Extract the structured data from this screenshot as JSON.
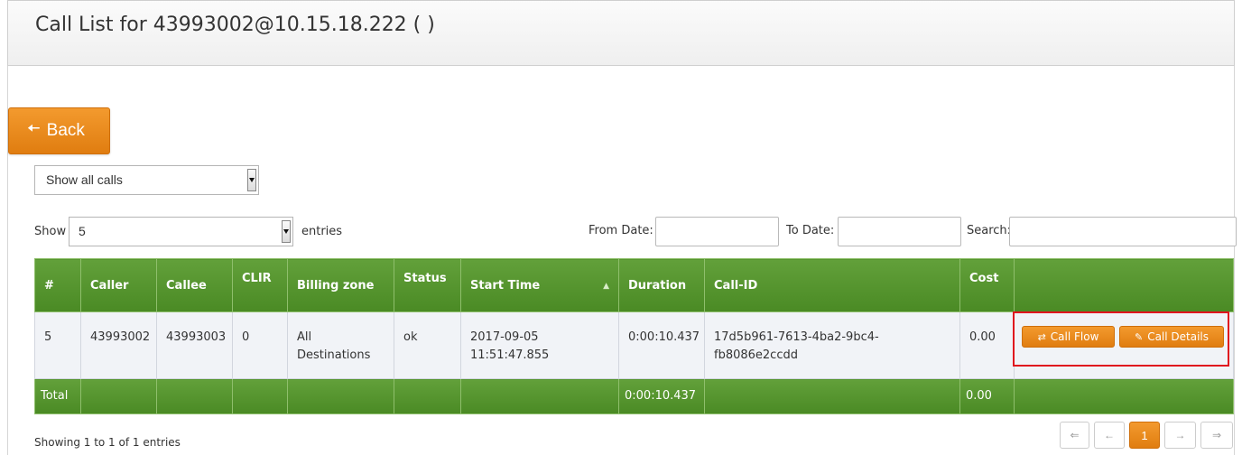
{
  "header": {
    "title": "Call List for 43993002@10.15.18.222 ( )"
  },
  "back_button": {
    "label": "Back"
  },
  "filter": {
    "selected": "Show all calls"
  },
  "length": {
    "show_label": "Show",
    "selected": "5",
    "entries_label": "entries"
  },
  "dates": {
    "from_label": "From Date:",
    "to_label": "To Date:",
    "search_label": "Search:"
  },
  "table": {
    "columns": [
      "#",
      "Caller",
      "Callee",
      "CLIR",
      "Billing zone",
      "Status",
      "Start Time",
      "Duration",
      "Call-ID",
      "Cost",
      ""
    ],
    "rows": [
      {
        "num": "5",
        "caller": "43993002",
        "callee": "43993003",
        "clir": "0",
        "zone_1": "All",
        "zone_2": "Destinations",
        "status": "ok",
        "start_date": "2017-09-05",
        "start_time": "11:51:47.855",
        "duration": "0:00:10.437",
        "call_id_1": "17d5b961-7613-4ba2-9bc4-",
        "call_id_2": "fb8086e2ccdd",
        "cost": "0.00"
      }
    ],
    "total": {
      "label": "Total",
      "duration": "0:00:10.437",
      "cost": "0.00"
    }
  },
  "actions": {
    "call_flow": "Call Flow",
    "call_details": "Call Details"
  },
  "footer": {
    "info": "Showing 1 to 1 of 1 entries"
  },
  "pagination": {
    "first": "⇐",
    "prev": "←",
    "current": "1",
    "next": "→",
    "last": "⇒"
  },
  "colors": {
    "accent": "#e8891c",
    "header_green": "#55942c",
    "highlight": "#e0141e"
  }
}
